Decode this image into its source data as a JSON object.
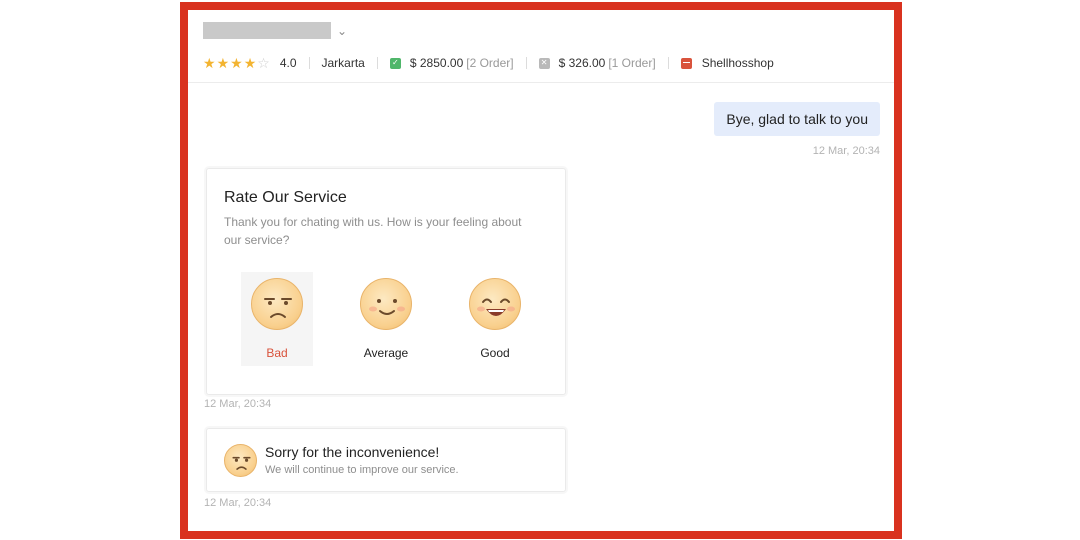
{
  "header": {
    "chevron": "⌄",
    "rating_stars": 4,
    "rating_max": 5,
    "rating_text": "4.0",
    "location": "Jarkarta",
    "completed": {
      "icon": "check-square-icon",
      "amount": "$ 2850.00",
      "orders": "[2 Order]"
    },
    "cancelled": {
      "icon": "x-square-icon",
      "amount": "$ 326.00",
      "orders": "[1 Order]"
    },
    "shop": {
      "icon": "shop-icon",
      "name": "Shellhosshop"
    }
  },
  "messages": {
    "outgoing_text": "Bye, glad to talk to you",
    "outgoing_time": "12 Mar, 20:34"
  },
  "rate_card": {
    "title": "Rate Our Service",
    "subtitle": "Thank you for chating with us. How is your feeling about our service?",
    "time": "12 Mar, 20:34",
    "options": [
      {
        "label": "Bad",
        "icon": "bad-face-icon",
        "selected": true
      },
      {
        "label": "Average",
        "icon": "average-face-icon",
        "selected": false
      },
      {
        "label": "Good",
        "icon": "good-face-icon",
        "selected": false
      }
    ]
  },
  "sorry_card": {
    "icon": "bad-face-icon",
    "title": "Sorry for the inconvenience!",
    "subtitle": "We will continue to improve our service.",
    "time": "12 Mar, 20:34"
  },
  "colors": {
    "frame": "#d9321f",
    "star": "#f3b431",
    "bubble": "#e4ecfb",
    "selected_label": "#d9533c"
  }
}
